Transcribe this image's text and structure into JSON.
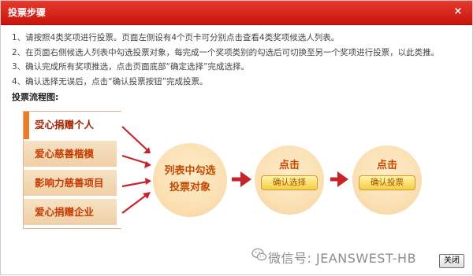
{
  "dialog": {
    "title": "投票步骤",
    "close_glyph": "×"
  },
  "instructions": [
    "1、请按照4类奖项进行投票。页面左侧设有4个页卡可分别点击查看4类奖项候选人列表。",
    "2、在页面右侧候选人列表中勾选投票对象，每完成一个奖项类别的勾选后可切换至另一个奖项进行投票，以此类推。",
    "3、确认完成所有奖项推选，点击页面底部“确定选择”完成选择。",
    "4、确认选择无误后，点击“确认投票按钮”完成投票。"
  ],
  "flow": {
    "title": "投票流程图:",
    "tabs": [
      {
        "label": "爱心捐赠个人",
        "active": true
      },
      {
        "label": "爱心慈善楷模",
        "active": false
      },
      {
        "label": "影响力慈善项目",
        "active": false
      },
      {
        "label": "爱心捐赠企业",
        "active": false
      }
    ],
    "tab_marker_glyph": ">",
    "step1": {
      "line1": "列表中勾选",
      "line2": "投票对象"
    },
    "step2": {
      "click_label": "点击",
      "button_label": "确认选择"
    },
    "step3": {
      "click_label": "点击",
      "button_label": "确认投票"
    }
  },
  "watermark": {
    "icon": "wechat-icon",
    "text": "微信号: JEANSWEST-HB"
  },
  "footer": {
    "close_button": "关闭"
  },
  "colors": {
    "title_bar": "#d8221a",
    "accent_text": "#c14a00",
    "arrow": "#c8252b",
    "circle": "#fbe0b3"
  }
}
